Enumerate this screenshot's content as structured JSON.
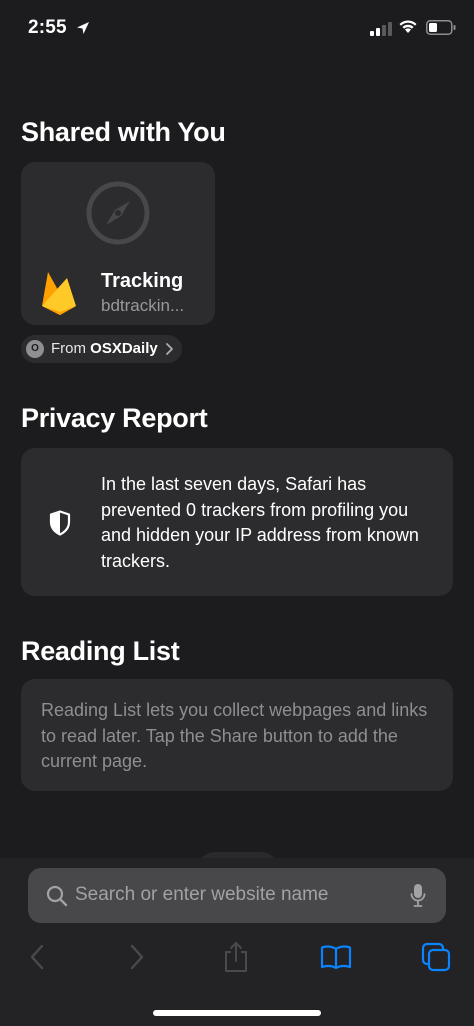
{
  "status_bar": {
    "time": "2:55"
  },
  "shared_with_you": {
    "title": "Shared with You",
    "card": {
      "title": "Tracking",
      "url": "bdtrackin..."
    },
    "from": {
      "avatar": "O",
      "prefix": "From ",
      "name": "OSXDaily"
    }
  },
  "privacy_report": {
    "title": "Privacy Report",
    "text": "In the last seven days, Safari has prevented 0 trackers from profiling you and hidden your IP address from known trackers."
  },
  "reading_list": {
    "title": "Reading List",
    "text": "Reading List lets you collect webpages and links to read later. Tap the Share button to add the current page."
  },
  "search": {
    "placeholder": "Search or enter website name",
    "value": ""
  },
  "toolbar": {
    "back_icon": "chevron-left-icon",
    "forward_icon": "chevron-right-icon",
    "share_icon": "share-icon",
    "bookmarks_icon": "book-icon",
    "tabs_icon": "tabs-icon"
  },
  "colors": {
    "background": "#1c1c1e",
    "card": "#2c2c2e",
    "accent": "#0a84ff",
    "secondary_text": "#8e8e93"
  }
}
